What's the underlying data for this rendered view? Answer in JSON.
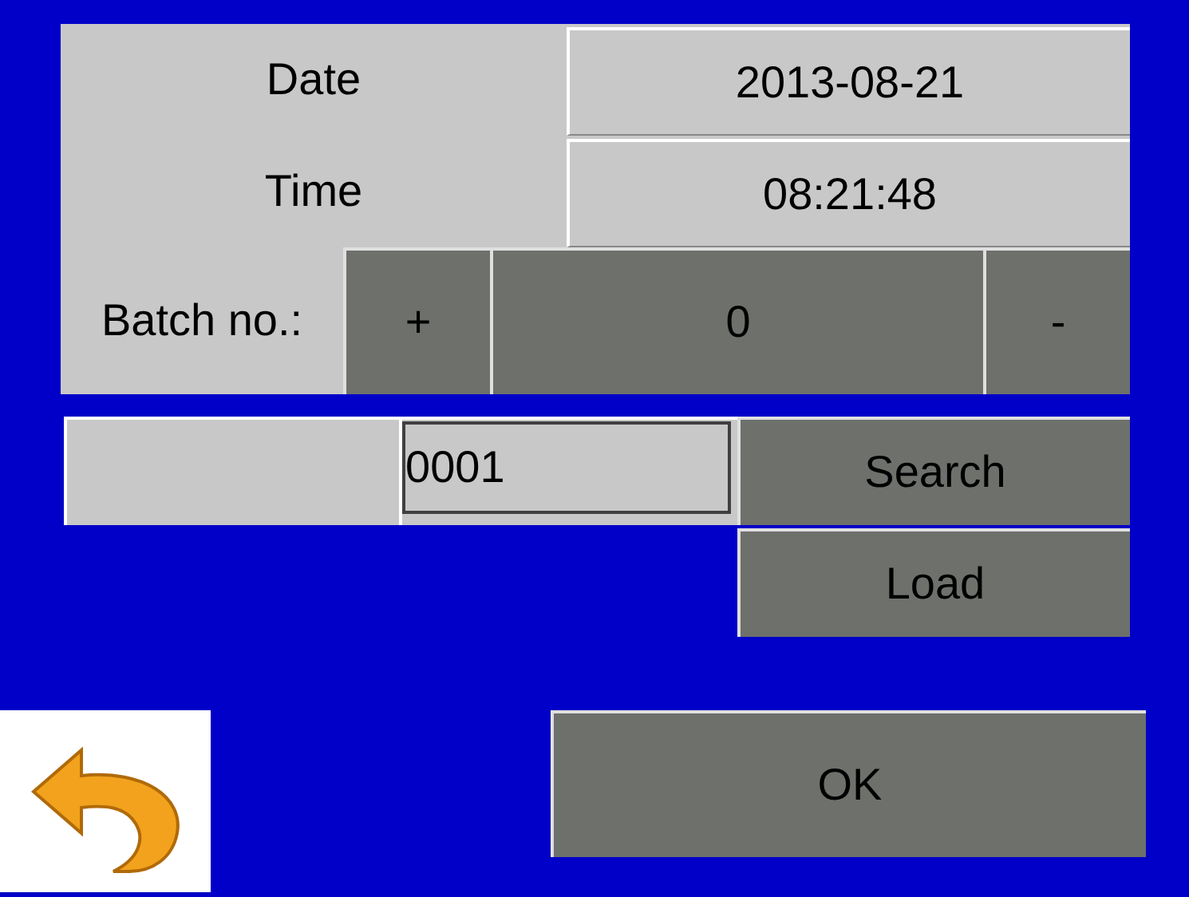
{
  "rows": [
    {
      "label": "Date",
      "value": "2013-08-21"
    },
    {
      "label": "Time",
      "value": "08:21:48"
    }
  ],
  "batch": {
    "label": "Batch no.:",
    "plus": "+",
    "value": "0",
    "minus": "-"
  },
  "search": {
    "value": "0001",
    "button": "Search"
  },
  "load_button": "Load",
  "ok_button": "OK"
}
